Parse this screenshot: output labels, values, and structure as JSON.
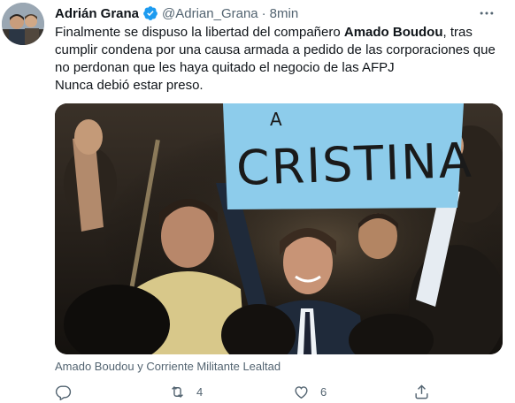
{
  "tweet": {
    "display_name": "Adrián Grana",
    "handle": "@Adrian_Grana",
    "separator": "·",
    "time": "8min",
    "text_parts": {
      "before_bold": "Finalmente se dispuso la libertad del compañero ",
      "bold": "Amado Boudou",
      "after_bold": ", tras cumplir condena por una causa armada a pedido de las corporaciones que no perdonan que les haya quitado el negocio de las AFPJ",
      "second_line": "Nunca debió estar preso."
    },
    "media": {
      "sign_text": "CRISTINA",
      "sign_top_letter": "A"
    },
    "caption": "Amado Boudou y Corriente Militante Lealtad"
  },
  "actions": {
    "reply_count": "",
    "retweet_count": "4",
    "like_count": "6"
  },
  "colors": {
    "verified": "#1d9bf0",
    "muted": "#536471",
    "sign": "#7fc4e6"
  },
  "icons": [
    "verified-badge-icon",
    "more-options-icon",
    "reply-icon",
    "retweet-icon",
    "like-icon",
    "share-icon"
  ]
}
